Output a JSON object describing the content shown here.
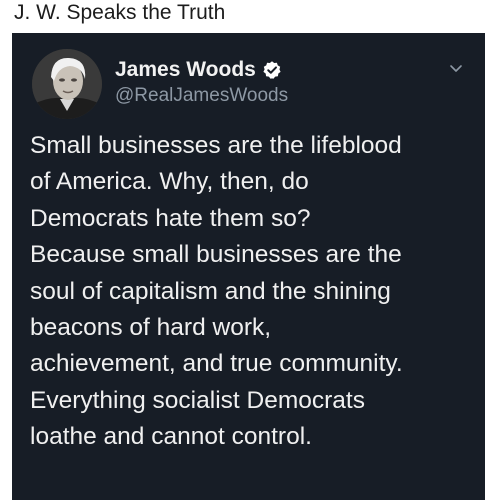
{
  "post": {
    "title": "J. W. Speaks the Truth"
  },
  "tweet": {
    "author": {
      "display_name": "James Woods",
      "handle": "@RealJamesWoods",
      "verified": true,
      "verified_icon": "verified-badge-icon"
    },
    "menu_icon": "chevron-down-icon",
    "text_lines": [
      "Small businesses are the lifeblood",
      "of America. Why, then, do",
      "Democrats hate them so?",
      "Because small businesses are the",
      "soul of capitalism and the shining",
      "beacons of hard work,",
      "achievement, and true community.",
      "Everything socialist Democrats",
      "loathe and cannot control."
    ]
  },
  "colors": {
    "card_background": "#171d26",
    "text_primary": "#f0f0f0",
    "text_secondary": "#8d98a4",
    "page_background": "#ffffff"
  }
}
